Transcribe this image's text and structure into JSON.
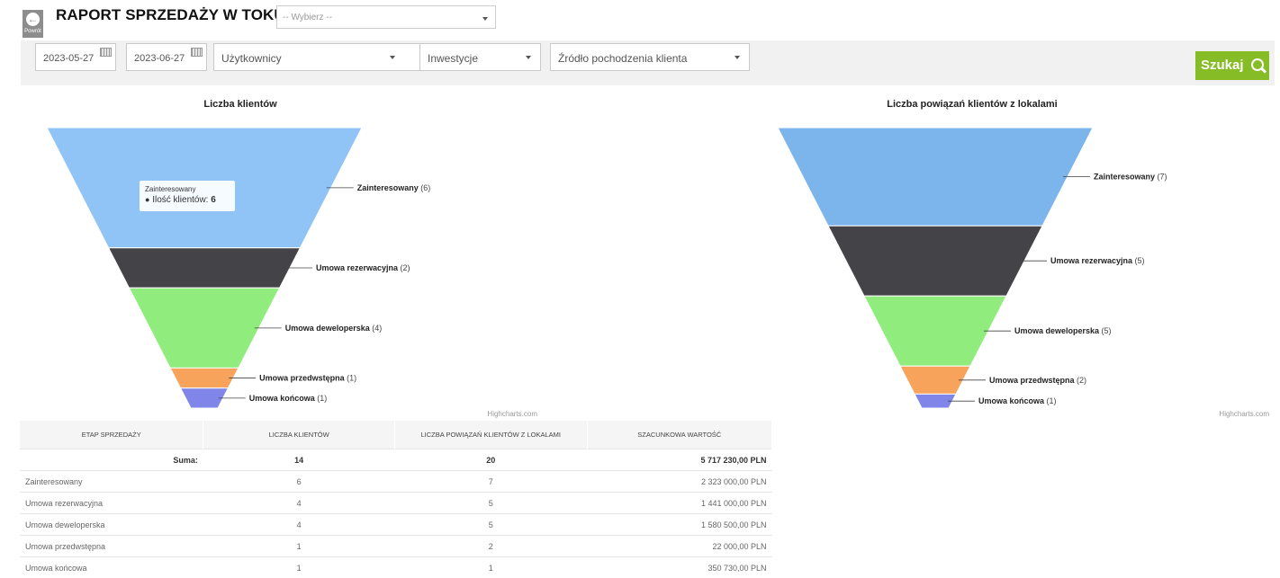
{
  "header": {
    "back_label": "Powrót",
    "title": "RAPORT SPRZEDAŻY W TOKU",
    "report_select_placeholder": "-- Wybierz --"
  },
  "filters": {
    "date_from": "2023-05-27",
    "date_to": "2023-06-27",
    "users": "Użytkownicy",
    "investments": "Inwestycje",
    "source": "Źródło pochodzenia klienta",
    "search_label": "Szukaj"
  },
  "charts": {
    "left_title": "Liczba klientów",
    "right_title": "Liczba powiązań klientów z lokalami",
    "credits": "Highcharts.com",
    "tooltip": {
      "title": "Zainteresowany",
      "label": "Ilość klientów:",
      "value": "6"
    }
  },
  "chart_data": [
    {
      "type": "funnel",
      "title": "Liczba klientów",
      "categories": [
        "Zainteresowany",
        "Umowa rezerwacyjna",
        "Umowa deweloperska",
        "Umowa przedwstępna",
        "Umowa końcowa"
      ],
      "values": [
        6,
        2,
        4,
        1,
        1
      ],
      "labels": [
        "Zainteresowany (6)",
        "Umowa rezerwacyjna (2)",
        "Umowa deweloperska (4)",
        "Umowa przedwstępna (1)",
        "Umowa końcowa (1)"
      ],
      "colors": [
        "#90c4f7",
        "#434348",
        "#90ed7d",
        "#f7a35c",
        "#8085e9"
      ]
    },
    {
      "type": "funnel",
      "title": "Liczba powiązań klientów z lokalami",
      "categories": [
        "Zainteresowany",
        "Umowa rezerwacyjna",
        "Umowa deweloperska",
        "Umowa przedwstępna",
        "Umowa końcowa"
      ],
      "values": [
        7,
        5,
        5,
        2,
        1
      ],
      "labels": [
        "Zainteresowany (7)",
        "Umowa rezerwacyjna (5)",
        "Umowa deweloperska (5)",
        "Umowa przedwstępna (2)",
        "Umowa końcowa (1)"
      ],
      "colors": [
        "#7cb5ec",
        "#434348",
        "#90ed7d",
        "#f7a35c",
        "#8085e9"
      ]
    }
  ],
  "table": {
    "headers": [
      "ETAP SPRZEDAŻY",
      "LICZBA KLIENTÓW",
      "LICZBA POWIĄZAŃ KLIENTÓW Z LOKALAMI",
      "SZACUNKOWA WARTOŚĆ"
    ],
    "sum_label": "Suma:",
    "sum": [
      "14",
      "20",
      "5 717 230,00 PLN"
    ],
    "rows": [
      [
        "Zainteresowany",
        "6",
        "7",
        "2 323 000,00 PLN"
      ],
      [
        "Umowa rezerwacyjna",
        "4",
        "5",
        "1 441 000,00 PLN"
      ],
      [
        "Umowa deweloperska",
        "4",
        "5",
        "1 580 500,00 PLN"
      ],
      [
        "Umowa przedwstępna",
        "1",
        "2",
        "22 000,00 PLN"
      ],
      [
        "Umowa końcowa",
        "1",
        "1",
        "350 730,00 PLN"
      ]
    ]
  }
}
